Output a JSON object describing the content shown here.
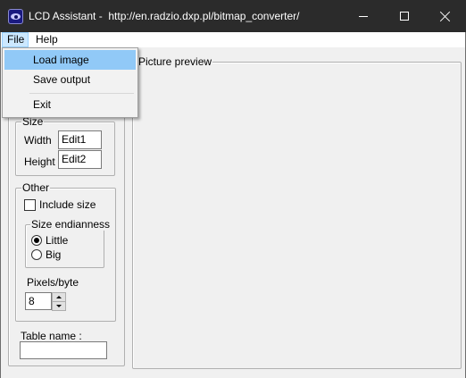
{
  "window": {
    "title": "LCD Assistant -  http://en.radzio.dxp.pl/bitmap_converter/",
    "icon": "lcd-eye-icon",
    "controls": [
      "minimize-icon",
      "maximize-icon",
      "close-icon"
    ]
  },
  "menubar": {
    "file_label": "File",
    "help_label": "Help"
  },
  "file_menu": {
    "items": [
      {
        "label": "Load image",
        "highlighted": true
      },
      {
        "label": "Save output"
      },
      {
        "label": "Exit"
      }
    ]
  },
  "size_group": {
    "label": "Size",
    "width_label": "Width",
    "width_value": "Edit1",
    "height_label": "Height",
    "height_value": "Edit2"
  },
  "other_group": {
    "label": "Other",
    "include_size_label": "Include size",
    "include_size_checked": false,
    "endianness": {
      "label": "Size endianness",
      "little_label": "Little",
      "big_label": "Big",
      "selected": "Little"
    },
    "pixels_label": "Pixels/byte",
    "pixels_value": "8"
  },
  "table_name": {
    "label": "Table name :",
    "value": ""
  },
  "preview": {
    "label": "Picture preview"
  },
  "colors": {
    "titlebar": "#2b2b2b",
    "menu_highlight": "#91c9f7",
    "menubar_active": "#cce8ff"
  }
}
